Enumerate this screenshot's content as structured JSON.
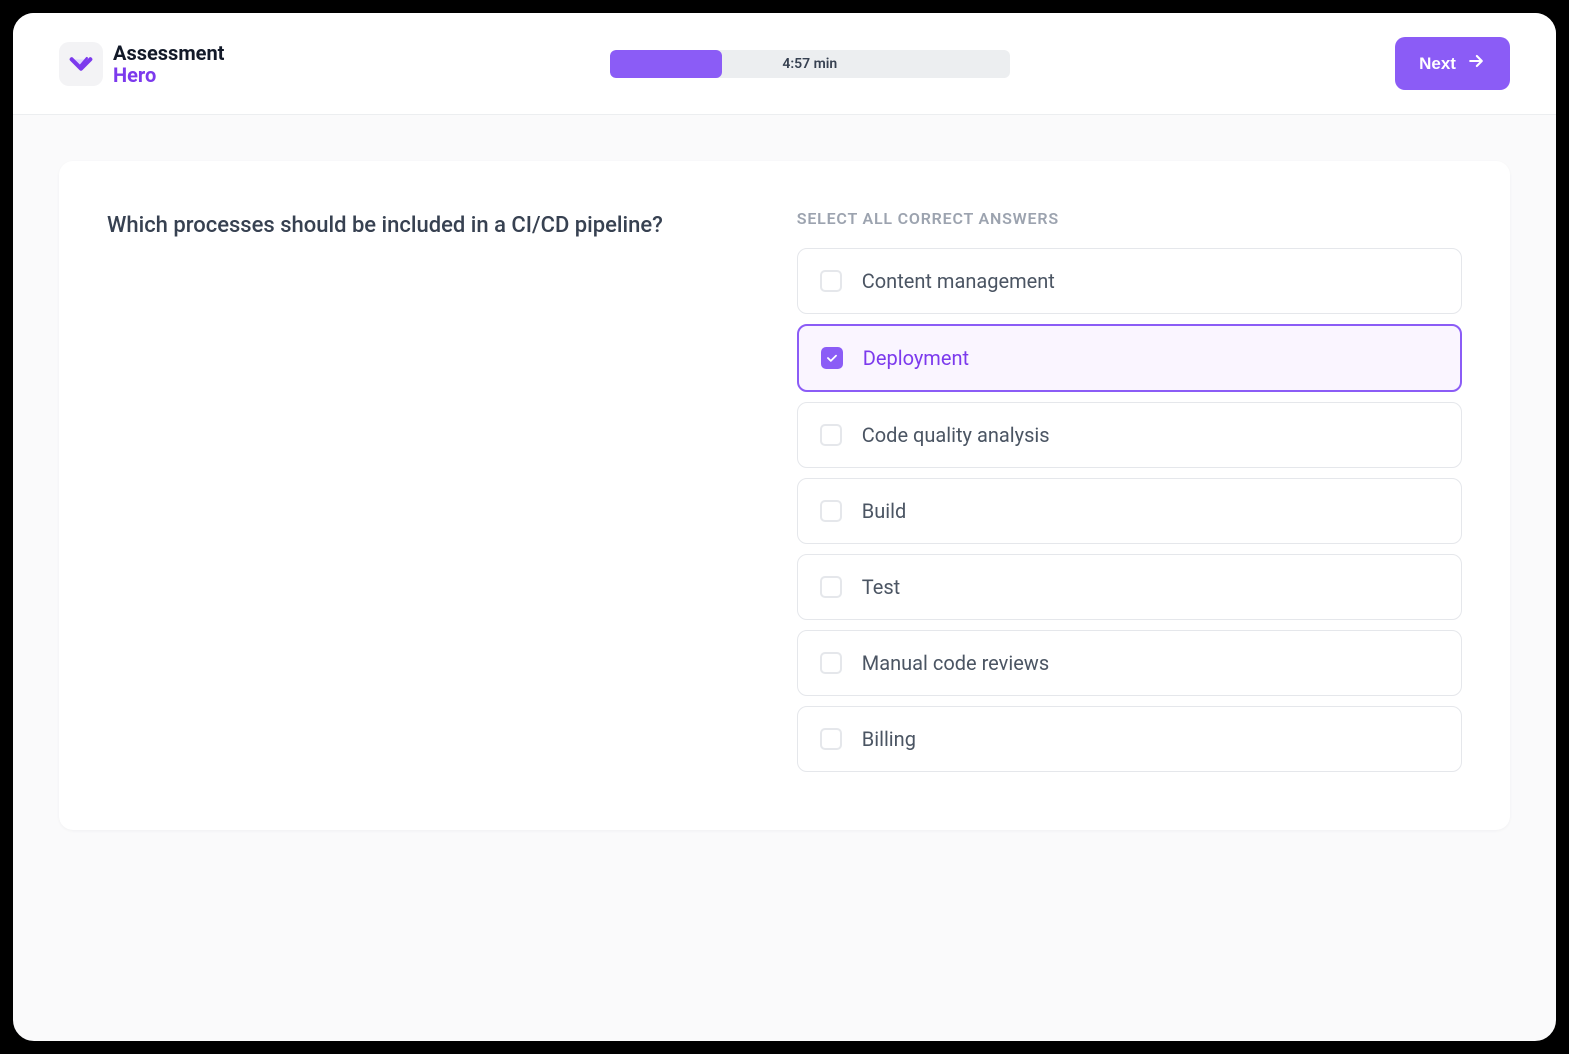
{
  "brand": {
    "line1": "Assessment",
    "line2": "Hero"
  },
  "timer": {
    "display": "4:57 min",
    "progress_percent": 28
  },
  "next_button": {
    "label": "Next"
  },
  "question": {
    "text": "Which processes should be included in a CI/CD pipeline?"
  },
  "answers": {
    "header": "SELECT ALL CORRECT ANSWERS",
    "options": [
      {
        "label": "Content management",
        "selected": false
      },
      {
        "label": "Deployment",
        "selected": true
      },
      {
        "label": "Code quality analysis",
        "selected": false
      },
      {
        "label": "Build",
        "selected": false
      },
      {
        "label": "Test",
        "selected": false
      },
      {
        "label": "Manual code reviews",
        "selected": false
      },
      {
        "label": "Billing",
        "selected": false
      }
    ]
  }
}
